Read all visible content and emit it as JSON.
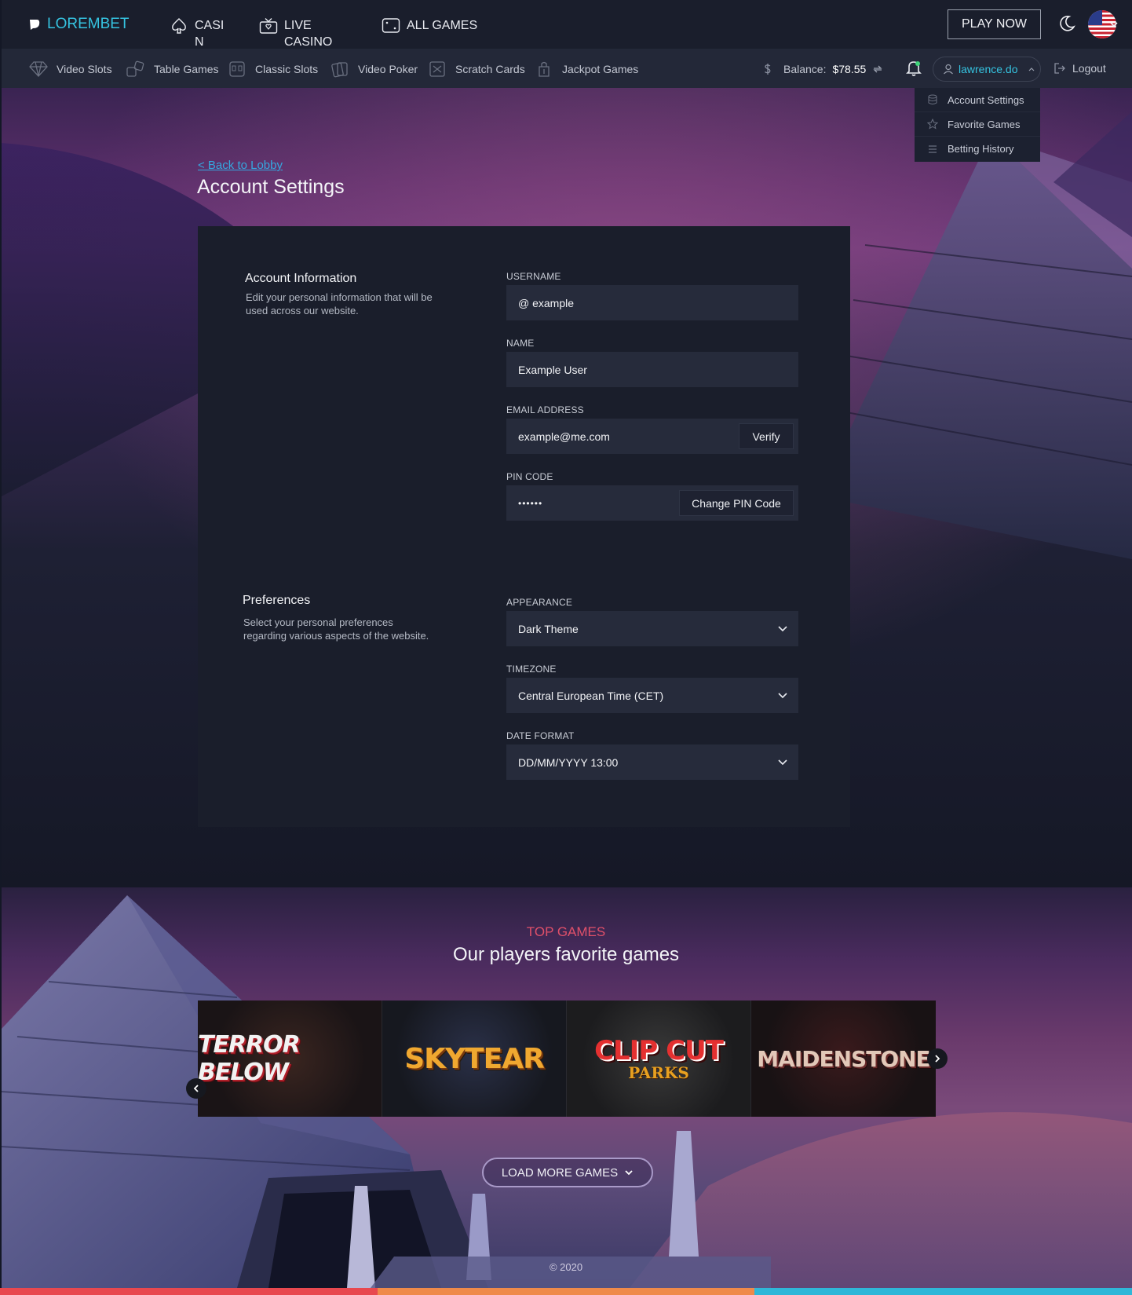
{
  "brand": {
    "name": "LOREMBET"
  },
  "topnav": [
    {
      "label": "CASIN\nO"
    },
    {
      "label": "LIVE\nCASINO"
    },
    {
      "label": "ALL GAMES"
    }
  ],
  "header": {
    "play_now": "PLAY NOW"
  },
  "subnav": [
    {
      "label": "Video Slots",
      "icon": "diamond-icon"
    },
    {
      "label": "Table Games",
      "icon": "dice-icon"
    },
    {
      "label": "Classic Slots",
      "icon": "slot-machine-icon"
    },
    {
      "label": "Video Poker",
      "icon": "cards-icon"
    },
    {
      "label": "Scratch Cards",
      "icon": "scratch-card-icon"
    },
    {
      "label": "Jackpot Games",
      "icon": "jackpot-icon"
    }
  ],
  "account": {
    "balance_label": "Balance:",
    "balance_value": "$78.55",
    "username": "lawrence.do",
    "logout": "Logout"
  },
  "user_menu": [
    {
      "label": "Account Settings"
    },
    {
      "label": "Favorite Games"
    },
    {
      "label": "Betting History"
    }
  ],
  "page": {
    "back_link": "< Back to Lobby",
    "title": "Account Settings"
  },
  "account_info": {
    "title": "Account Information",
    "description": "Edit your personal information that will be used across our website.",
    "username_label": "USERNAME",
    "username_value": "@ example",
    "name_label": "NAME",
    "name_value": "Example User",
    "email_label": "EMAIL ADDRESS",
    "email_value": "example@me.com",
    "verify_button": "Verify",
    "pin_label": "PIN CODE",
    "pin_value": "••••••",
    "change_pin_button": "Change PIN Code"
  },
  "preferences": {
    "title": "Preferences",
    "description": "Select your personal preferences regarding various aspects of the website.",
    "appearance_label": "APPEARANCE",
    "appearance_value": "Dark Theme",
    "timezone_label": "TIMEZONE",
    "timezone_value": "Central European Time (CET)",
    "date_format_label": "DATE FORMAT",
    "date_format_value": "DD/MM/YYYY 13:00"
  },
  "top_games": {
    "label": "TOP GAMES",
    "title": "Our players favorite games",
    "games": [
      {
        "title": "TERROR BELOW"
      },
      {
        "title": "SKYTEAR"
      },
      {
        "title": "CLIP CUT",
        "subtitle": "PARKS"
      },
      {
        "title": "MAIDENSTONE"
      }
    ],
    "load_more": "LOAD MORE GAMES"
  },
  "footer": {
    "copyright": "© 2020"
  },
  "colors": {
    "accent": "#35c3e0",
    "link": "#35a8e0",
    "top_label": "#e0506a",
    "strip": [
      "#e8484f",
      "#ef8a4a",
      "#2fb7d8"
    ]
  }
}
